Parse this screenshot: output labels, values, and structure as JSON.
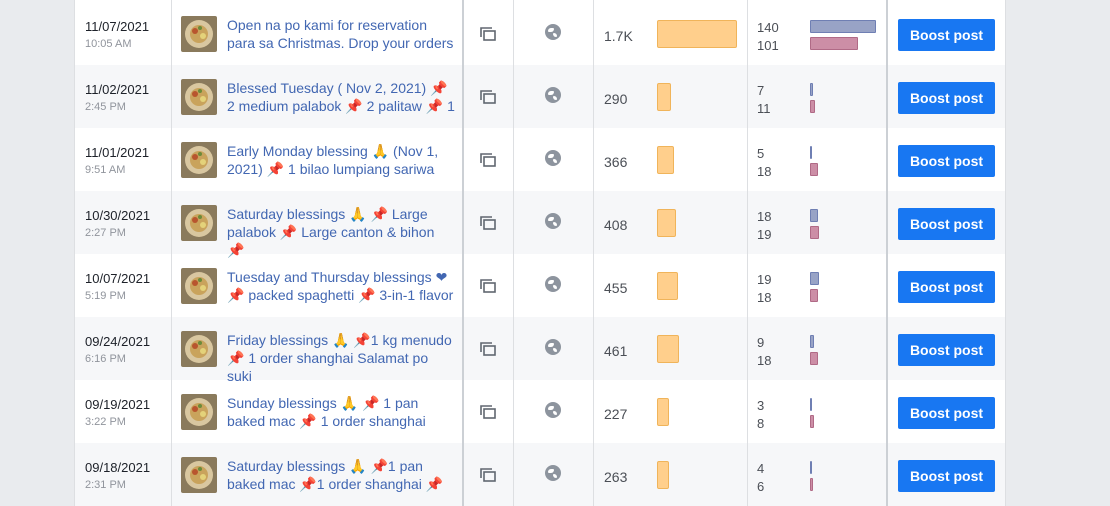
{
  "colors": {
    "boost_button": "#1877f2",
    "link": "#4267b2",
    "reach_bar": "#ffcf8c",
    "engagement_bar_1": "#98a3c6",
    "engagement_bar_2": "#cc8ea6"
  },
  "icons": {
    "type": "multi-photo-icon",
    "audience": "globe-icon",
    "pin": "pushpin-icon",
    "prayer": "folded-hands-icon",
    "heart": "heart-icon"
  },
  "posts": [
    {
      "date": "11/07/2021",
      "time": "10:05 AM",
      "title": "Open na po kami for reservation para sa Christmas. Drop your orders",
      "reach": "1.7K",
      "reach_value": 1700,
      "eng1": "140",
      "eng2": "101",
      "eng1_value": 140,
      "eng2_value": 101,
      "boost_label": "Boost post"
    },
    {
      "date": "11/02/2021",
      "time": "2:45 PM",
      "title": "Blessed Tuesday ( Nov 2, 2021) 📌 2 medium palabok 📌 2 palitaw 📌 1",
      "reach": "290",
      "reach_value": 290,
      "eng1": "7",
      "eng2": "11",
      "eng1_value": 7,
      "eng2_value": 11,
      "boost_label": "Boost post"
    },
    {
      "date": "11/01/2021",
      "time": "9:51 AM",
      "title": "Early Monday blessing 🙏 (Nov 1, 2021) 📌 1 bilao lumpiang sariwa",
      "reach": "366",
      "reach_value": 366,
      "eng1": "5",
      "eng2": "18",
      "eng1_value": 5,
      "eng2_value": 18,
      "boost_label": "Boost post"
    },
    {
      "date": "10/30/2021",
      "time": "2:27 PM",
      "title": "Saturday blessings 🙏 📌 Large palabok 📌 Large canton & bihon 📌",
      "reach": "408",
      "reach_value": 408,
      "eng1": "18",
      "eng2": "19",
      "eng1_value": 18,
      "eng2_value": 19,
      "boost_label": "Boost post"
    },
    {
      "date": "10/07/2021",
      "time": "5:19 PM",
      "title": "Tuesday and Thursday blessings ❤ 📌 packed spaghetti 📌 3-in-1 flavor",
      "reach": "455",
      "reach_value": 455,
      "eng1": "19",
      "eng2": "18",
      "eng1_value": 19,
      "eng2_value": 18,
      "boost_label": "Boost post"
    },
    {
      "date": "09/24/2021",
      "time": "6:16 PM",
      "title": "Friday blessings 🙏 📌1 kg menudo 📌 1 order shanghai Salamat po suki",
      "reach": "461",
      "reach_value": 461,
      "eng1": "9",
      "eng2": "18",
      "eng1_value": 9,
      "eng2_value": 18,
      "boost_label": "Boost post"
    },
    {
      "date": "09/19/2021",
      "time": "3:22 PM",
      "title": "Sunday blessings 🙏 📌 1 pan baked mac 📌 1 order shanghai",
      "reach": "227",
      "reach_value": 227,
      "eng1": "3",
      "eng2": "8",
      "eng1_value": 3,
      "eng2_value": 8,
      "boost_label": "Boost post"
    },
    {
      "date": "09/18/2021",
      "time": "2:31 PM",
      "title": "Saturday blessings 🙏 📌1 pan baked mac 📌1 order shanghai 📌",
      "reach": "263",
      "reach_value": 263,
      "eng1": "4",
      "eng2": "6",
      "eng1_value": 4,
      "eng2_value": 6,
      "boost_label": "Boost post"
    }
  ]
}
